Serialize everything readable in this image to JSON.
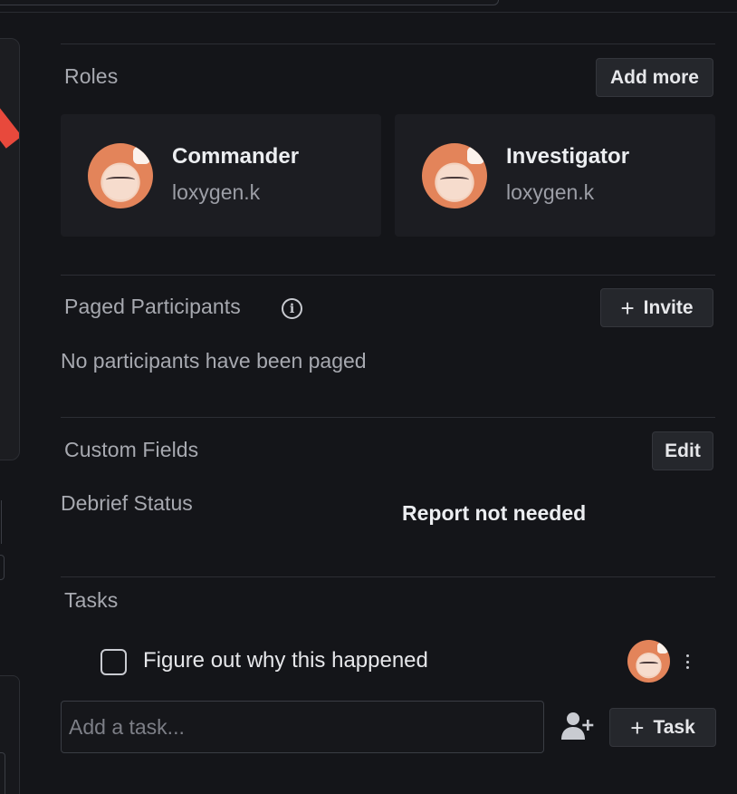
{
  "roles": {
    "title": "Roles",
    "add_more_label": "Add more",
    "cards": [
      {
        "role": "Commander",
        "user": "loxygen.k"
      },
      {
        "role": "Investigator",
        "user": "loxygen.k"
      }
    ]
  },
  "paged_participants": {
    "title": "Paged Participants",
    "info_icon": "info-icon",
    "invite_label": "Invite",
    "empty_text": "No participants have been paged"
  },
  "custom_fields": {
    "title": "Custom Fields",
    "edit_label": "Edit",
    "fields": [
      {
        "label": "Debrief Status",
        "value": "Report not needed"
      }
    ]
  },
  "tasks": {
    "title": "Tasks",
    "items": [
      {
        "label": "Figure out why this happened",
        "checked": false
      }
    ],
    "input_placeholder": "Add a task...",
    "add_task_label": "Task",
    "assign_icon": "add-person-icon"
  },
  "colors": {
    "background": "#141519",
    "card": "#1c1d22",
    "button": "#25272c",
    "accent_ribbon": "#e8493c"
  }
}
